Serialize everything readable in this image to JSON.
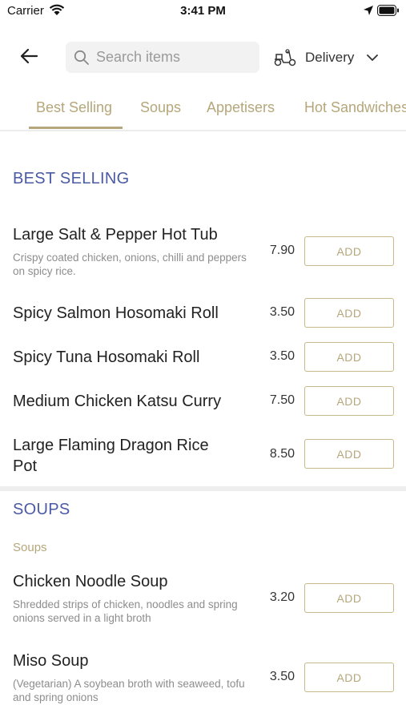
{
  "status_bar": {
    "carrier": "Carrier",
    "time": "3:41 PM"
  },
  "search": {
    "placeholder": "Search items"
  },
  "delivery": {
    "label": "Delivery"
  },
  "tabs": [
    {
      "label": "Best Selling",
      "active": true
    },
    {
      "label": "Soups",
      "active": false
    },
    {
      "label": "Appetisers",
      "active": false
    },
    {
      "label": "Hot Sandwiches",
      "active": false
    }
  ],
  "sections": [
    {
      "title": "BEST SELLING",
      "items": [
        {
          "name": "Large Salt & Pepper Hot Tub",
          "description": "Crispy coated chicken, onions, chilli and peppers on spicy rice.",
          "price": "7.90",
          "button": "ADD"
        },
        {
          "name": "Spicy Salmon Hosomaki Roll",
          "description": "",
          "price": "3.50",
          "button": "ADD"
        },
        {
          "name": "Spicy Tuna Hosomaki Roll",
          "description": "",
          "price": "3.50",
          "button": "ADD"
        },
        {
          "name": "Medium Chicken Katsu Curry",
          "description": "",
          "price": "7.50",
          "button": "ADD"
        },
        {
          "name": "Large Flaming Dragon Rice Pot",
          "description": "",
          "price": "8.50",
          "button": "ADD"
        }
      ]
    },
    {
      "title": "SOUPS",
      "subtitle": "Soups",
      "items": [
        {
          "name": "Chicken Noodle Soup",
          "description": "Shredded strips of chicken, noodles and spring onions served in a light broth",
          "price": "3.20",
          "button": "ADD"
        },
        {
          "name": "Miso Soup",
          "description": "(Vegetarian) A soybean broth with seaweed, tofu and spring onions",
          "price": "3.50",
          "button": "ADD"
        }
      ]
    }
  ],
  "colors": {
    "accent": "#b5a77b",
    "section_title": "#4a5aa5",
    "divider": "#eeeeee"
  }
}
